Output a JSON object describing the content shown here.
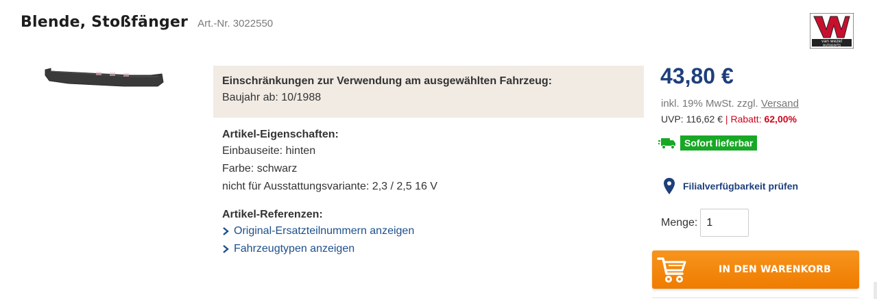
{
  "product": {
    "title": "Blende, Stoßfänger",
    "article_number": "Art.-Nr. 3022550"
  },
  "brand": {
    "logo_text_line1": "van wezel",
    "logo_text_line2": "autoparts",
    "logo_color": "#c8102e"
  },
  "restrictions": {
    "heading": "Einschränkungen zur Verwendung am ausgewählten Fahrzeug:",
    "line": "Baujahr ab: 10/1988"
  },
  "properties": {
    "heading": "Artikel-Eigenschaften:",
    "lines": [
      "Einbauseite: hinten",
      "Farbe: schwarz",
      "nicht für Ausstattungsvariante: 2,3 / 2,5 16 V"
    ]
  },
  "references": {
    "heading": "Artikel-Referenzen:",
    "links": [
      "Original-Ersatzteilnummern anzeigen",
      "Fahrzeugtypen anzeigen"
    ]
  },
  "pricing": {
    "price": "43,80 €",
    "tax_prefix": "inkl. 19% MwSt. zzgl.",
    "shipping_link": "Versand",
    "uvp_text": "UVP: 116,62 €",
    "separator": "|",
    "rabatt_label": "Rabatt:",
    "rabatt_value": "62,00%"
  },
  "availability": {
    "label": "Sofort lieferbar",
    "color": "#18a826"
  },
  "store_check": {
    "label": "Filialverfügbarkeit prüfen"
  },
  "quantity": {
    "label": "Menge:",
    "value": "1"
  },
  "cart": {
    "label": "IN DEN WARENKORB",
    "color": "#f08300"
  },
  "colors": {
    "brand_blue": "#1d3f7c",
    "link_blue": "#1c4f8a",
    "discount_red": "#d0021b",
    "restriction_bg": "#f1ebe4"
  }
}
